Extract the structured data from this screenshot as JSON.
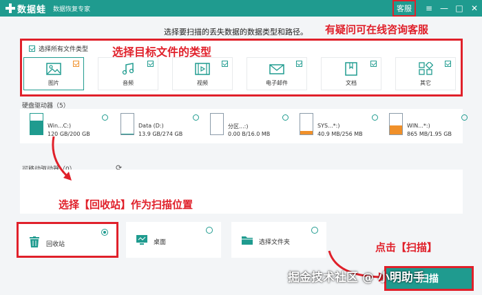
{
  "titlebar": {
    "app_name": "数据蛙",
    "subtitle": "数据恢复专家",
    "kefu_label": "客服",
    "menu_icon": "≡",
    "minimize_icon": "—",
    "maximize_icon": "□",
    "close_icon": "✕"
  },
  "instruction": "选择要扫描的丢失数据的数据类型和路径。",
  "annotations": {
    "consult": "有疑问可在线咨询客服",
    "select_type": "选择目标文件的类型",
    "recycle": "选择【回收站】作为扫描位置",
    "scan": "点击【扫描】"
  },
  "file_types": {
    "select_all_label": "选择所有文件类型",
    "items": [
      {
        "label": "图片",
        "icon": "image-icon"
      },
      {
        "label": "音频",
        "icon": "music-icon"
      },
      {
        "label": "视频",
        "icon": "video-icon"
      },
      {
        "label": "电子邮件",
        "icon": "mail-icon"
      },
      {
        "label": "文档",
        "icon": "document-icon"
      },
      {
        "label": "其它",
        "icon": "other-icon"
      }
    ]
  },
  "hard_drives": {
    "label": "硬盘驱动器（5）",
    "items": [
      {
        "name": "Win...C:)",
        "size": "120 GB/200 GB",
        "used_fraction": 0.6
      },
      {
        "name": "Data (D:)",
        "size": "13.9 GB/274 GB",
        "used_fraction": 0.05
      },
      {
        "name": "分区...:)",
        "size": "0.00  B/16.0 MB",
        "used_fraction": 0.0
      },
      {
        "name": "SYS...*:)",
        "size": "40.9 MB/256 MB",
        "used_fraction": 0.16
      },
      {
        "name": "WIN...*:)",
        "size": "865 MB/1.95 GB",
        "used_fraction": 0.44
      }
    ]
  },
  "removable": {
    "label": "可移动驱动器（0）",
    "refresh_icon": "⟳"
  },
  "locations": [
    {
      "label": "回收站",
      "icon": "trash-icon"
    },
    {
      "label": "桌面",
      "icon": "desktop-icon"
    },
    {
      "label": "选择文件夹",
      "icon": "folder-icon"
    }
  ],
  "scan_label": "扫描",
  "watermark": "掘金技术社区 @ 小明助手",
  "colors": {
    "accent": "#1f9b8f",
    "highlight": "#e0202a",
    "warning": "#f0902a"
  }
}
